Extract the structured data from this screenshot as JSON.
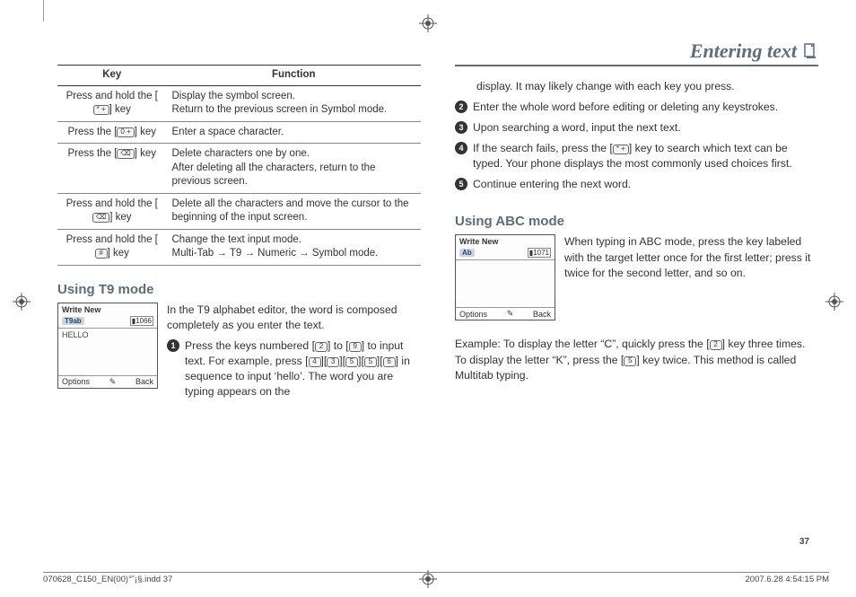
{
  "chapter": {
    "title": "Entering text"
  },
  "table": {
    "headers": {
      "key": "Key",
      "fn": "Function"
    },
    "rows": [
      {
        "key_pre": "Press and hold the [",
        "key_glyph": "* +",
        "key_post": "] key",
        "fn": "Display the symbol screen.\nReturn to the previous screen in Symbol mode."
      },
      {
        "key_pre": "Press the [",
        "key_glyph": "0 +",
        "key_post": "] key",
        "fn": "Enter a space character."
      },
      {
        "key_pre": "Press the [",
        "key_glyph": "⌫",
        "key_post": "] key",
        "fn": "Delete characters one by one.\nAfter deleting all the characters, return to the previous screen."
      },
      {
        "key_pre": "Press and hold the [",
        "key_glyph": "⌫",
        "key_post": "] key",
        "fn": "Delete all the characters and move the cursor to the beginning of the input screen."
      },
      {
        "key_pre": "Press and hold the [",
        "key_glyph": "#",
        "key_post": "] key",
        "fn": "Change the text input mode.\nMulti-Tab → T9 → Numeric → Symbol mode."
      }
    ]
  },
  "t9": {
    "heading": "Using T9 mode",
    "screen": {
      "title": "Write New",
      "mode": "T9ab",
      "batt": "1066",
      "body": "HELLO",
      "soft_left": "Options",
      "soft_mid": "✎",
      "soft_right": "Back"
    },
    "intro": "In the T9 alphabet editor, the word is composed completely as you enter the text.",
    "steps": [
      {
        "n": "1",
        "pre": "Press the keys numbered [",
        "g1": "2",
        "mid1": "] to [",
        "g2": "9",
        "mid2": "] to input text. For example, press [",
        "seq": [
          "4",
          "3",
          "5",
          "5",
          "6"
        ],
        "post": "] in sequence to input ‘hello’. The word you are typing appears on the",
        "cont": "display. It may likely change with each key you press."
      },
      {
        "n": "2",
        "text": "Enter the whole word before editing or deleting any keystrokes."
      },
      {
        "n": "3",
        "text": "Upon searching a word, input the next text."
      },
      {
        "n": "4",
        "pre": "If the search fails, press the [",
        "g1": "* +",
        "post": "] key to search which text can be typed. Your phone displays the most commonly used choices first."
      },
      {
        "n": "5",
        "text": "Continue entering the next word."
      }
    ]
  },
  "abc": {
    "heading": "Using ABC mode",
    "screen": {
      "title": "Write New",
      "mode": "Ab",
      "batt": "1071",
      "body": "",
      "soft_left": "Options",
      "soft_mid": "✎",
      "soft_right": "Back"
    },
    "para": "When typing in ABC mode, press the key labeled with the target letter once for the first letter; press it twice for the second letter, and so on.",
    "example_pre": "Example: To display the letter “C”, quickly press the [",
    "example_g1": "2",
    "example_mid": "] key three times. To display the letter “K”, press the [",
    "example_g2": "5",
    "example_post": "] key twice. This method is called Multitab typing."
  },
  "page_number": "37",
  "footer": {
    "left": "070628_C150_EN(00)°˘¡§.indd   37",
    "right": "2007.6.28   4:54:15 PM"
  }
}
